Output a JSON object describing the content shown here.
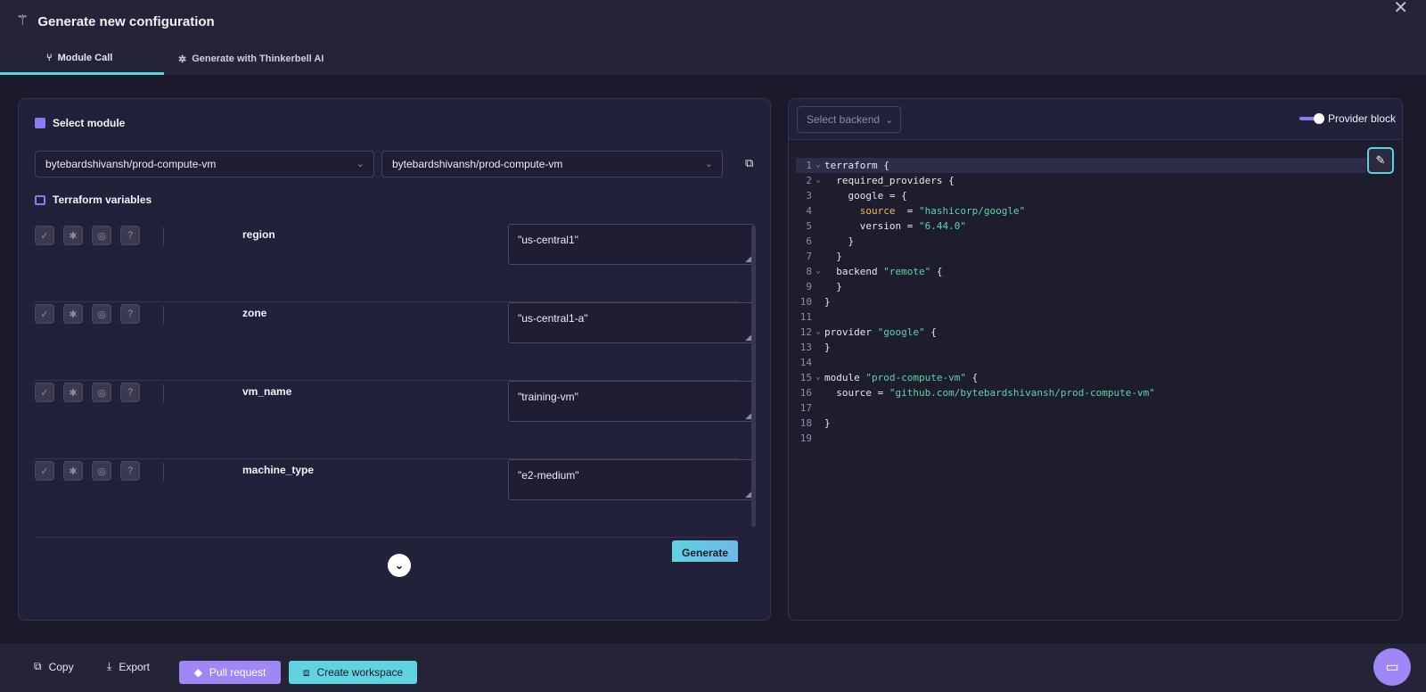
{
  "header": {
    "title": "Generate new configuration",
    "wand_icon": "magic-wand-icon",
    "close_icon": "close-icon",
    "tabs": [
      {
        "label": "Module Call",
        "icon": "module-icon",
        "active": true
      },
      {
        "label": "Generate with Thinkerbell AI",
        "icon": "ai-icon",
        "active": false
      }
    ]
  },
  "left": {
    "select_module_title": "Select module",
    "terraform_vars_title": "Terraform variables",
    "module_select_1": "bytebardshivansh/prod-compute-vm",
    "module_select_2": "bytebardshivansh/prod-compute-vm",
    "variables": [
      {
        "name": "region",
        "value": "\"us-central1\""
      },
      {
        "name": "zone",
        "value": "\"us-central1-a\""
      },
      {
        "name": "vm_name",
        "value": "\"training-vm\""
      },
      {
        "name": "machine_type",
        "value": "\"e2-medium\""
      }
    ],
    "generate_label": "Generate"
  },
  "right": {
    "backend_placeholder": "Select backend",
    "provider_block_label": "Provider block",
    "provider_block_on": true,
    "code_lines": [
      "terraform {",
      "  required_providers {",
      "    google = {",
      "      source  = \"hashicorp/google\"",
      "      version = \"6.44.0\"",
      "    }",
      "  }",
      "  backend \"remote\" {",
      "  }",
      "}",
      "",
      "provider \"google\" {",
      "}",
      "",
      "module \"prod-compute-vm\" {",
      "  source = \"github.com/bytebardshivansh/prod-compute-vm\"",
      "",
      "}",
      ""
    ]
  },
  "footer": {
    "copy_label": "Copy",
    "export_label": "Export",
    "pull_request_label": "Pull request",
    "create_workspace_label": "Create workspace"
  },
  "colors": {
    "accent_purple": "#9f87f6",
    "accent_cyan": "#5fd3e0",
    "background": "#1b1a2b"
  }
}
